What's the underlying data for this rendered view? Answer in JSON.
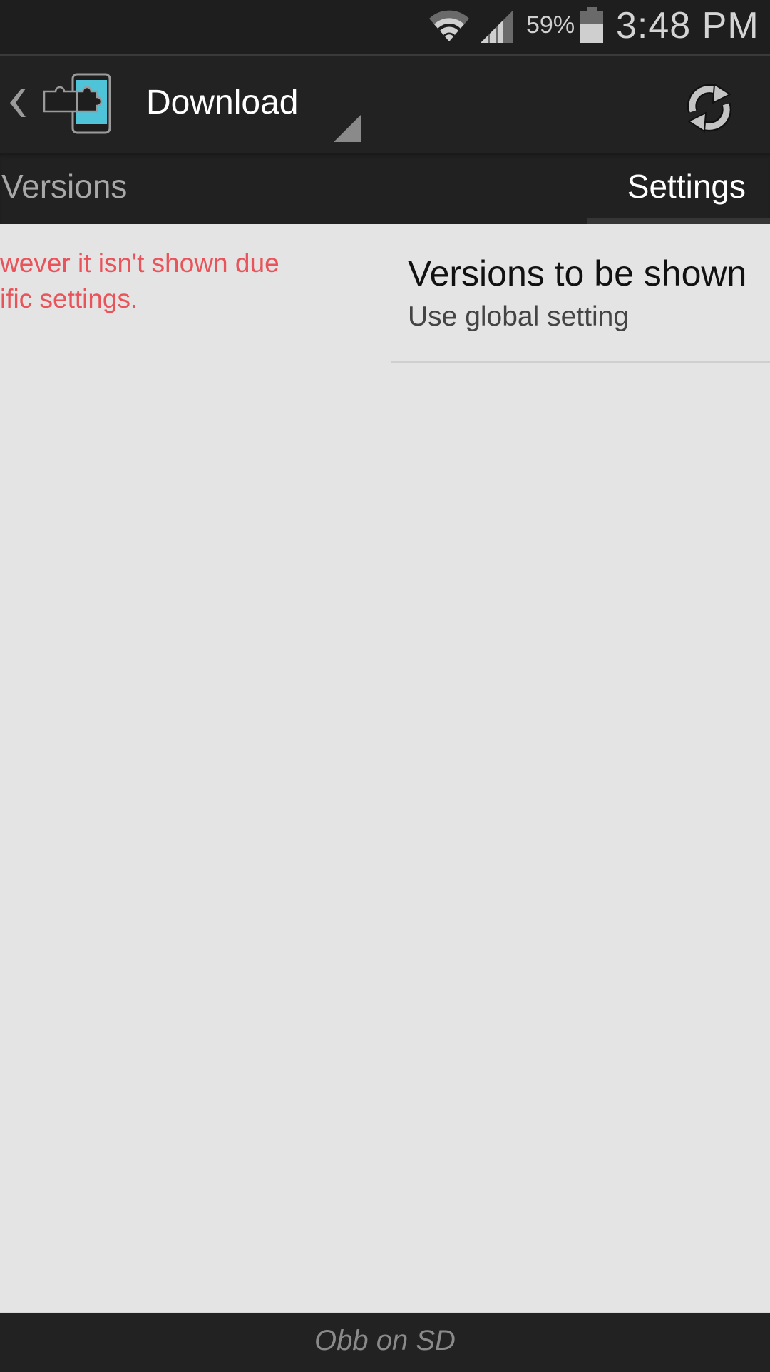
{
  "status_bar": {
    "battery_percent": "59%",
    "battery_level": 0.59,
    "time": "3:48 PM",
    "icons": [
      "wifi-icon",
      "cell-signal-icon",
      "battery-icon"
    ]
  },
  "action_bar": {
    "title": "Download",
    "icons": [
      "back-chevron-icon",
      "xposed-app-icon",
      "dropdown-triangle-icon",
      "refresh-icon"
    ]
  },
  "tabs": [
    {
      "label": "Versions",
      "selected": false
    },
    {
      "label": "Settings",
      "selected": true
    }
  ],
  "versions_panel": {
    "warning_text": "wever it isn't shown due\nific settings."
  },
  "settings_panel": {
    "preference": {
      "title": "Versions to be shown",
      "summary": "Use global setting"
    }
  },
  "footer": {
    "text": "Obb on SD"
  },
  "colors": {
    "accent_warning": "#e8545a",
    "app_icon_screen": "#4fc3d7",
    "bar_background": "#222222",
    "content_background": "#e4e4e4"
  }
}
